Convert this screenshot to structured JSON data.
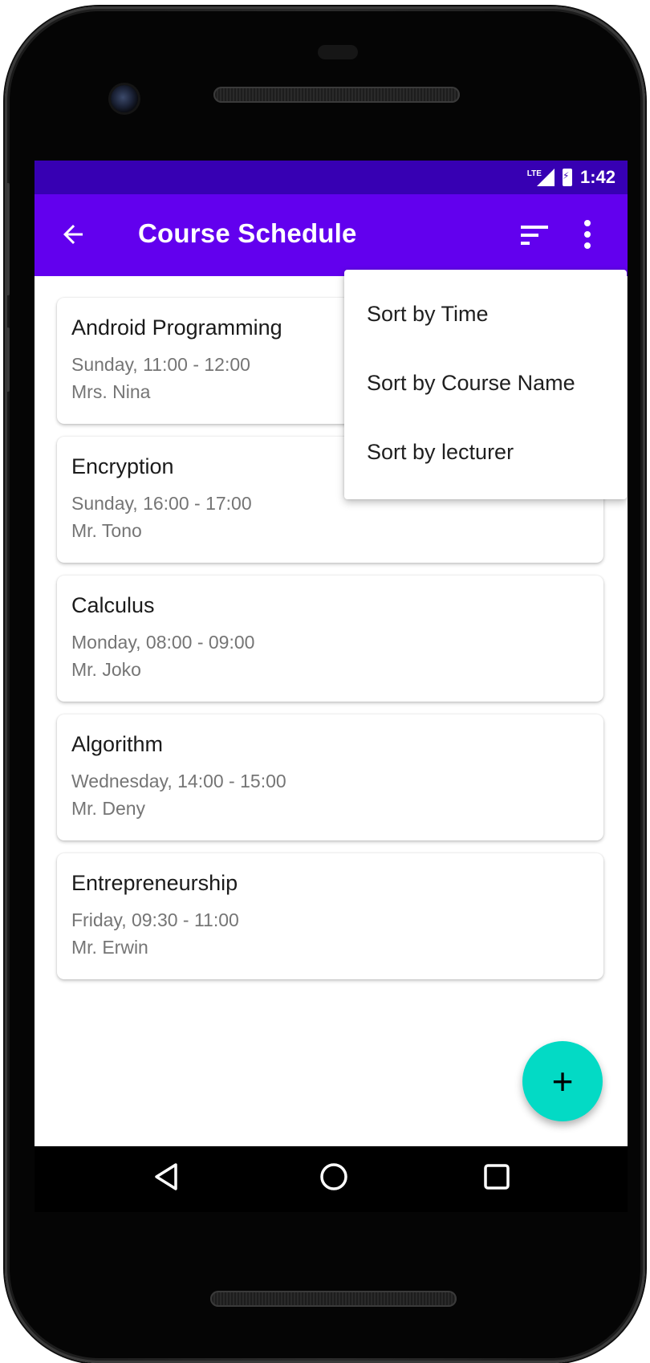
{
  "status_bar": {
    "network": "LTE",
    "time": "1:42"
  },
  "app_bar": {
    "title": "Course Schedule",
    "back_icon": "arrow-left-icon",
    "sort_icon": "sort-icon",
    "more_icon": "more-vert-icon"
  },
  "courses": [
    {
      "name": "Android Programming",
      "time": "Sunday, 11:00 - 12:00",
      "lecturer": "Mrs. Nina"
    },
    {
      "name": "Encryption",
      "time": "Sunday, 16:00 - 17:00",
      "lecturer": "Mr. Tono"
    },
    {
      "name": "Calculus",
      "time": "Monday, 08:00 - 09:00",
      "lecturer": "Mr. Joko"
    },
    {
      "name": "Algorithm",
      "time": "Wednesday, 14:00 - 15:00",
      "lecturer": "Mr. Deny"
    },
    {
      "name": "Entrepreneurship",
      "time": "Friday, 09:30 - 11:00",
      "lecturer": "Mr. Erwin"
    }
  ],
  "sort_menu": {
    "items": [
      "Sort by Time",
      "Sort by Course Name",
      "Sort by lecturer"
    ]
  },
  "fab": {
    "label": "+"
  },
  "colors": {
    "status_bar": "#3700b3",
    "app_bar": "#6200ee",
    "fab": "#03dac5",
    "secondary_text": "#757575"
  }
}
